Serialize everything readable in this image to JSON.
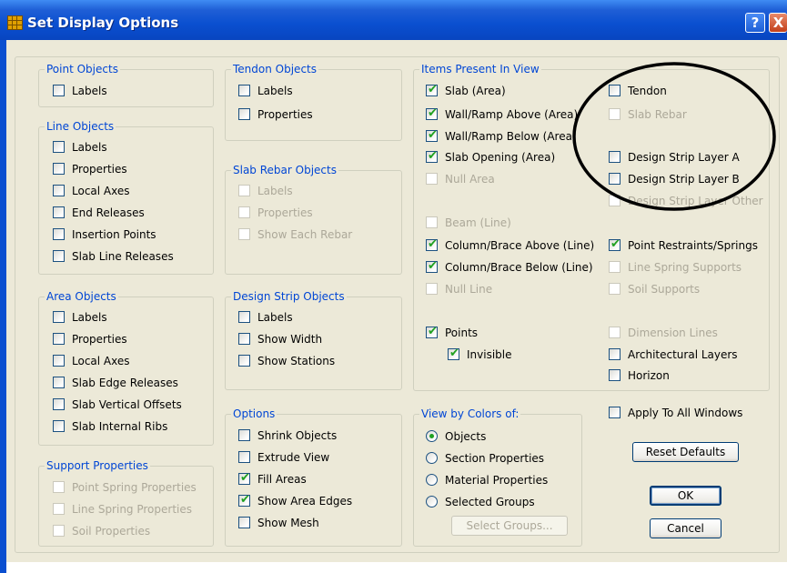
{
  "window": {
    "title": "Set Display Options",
    "help_glyph": "?",
    "close_glyph": "X"
  },
  "point_objects": {
    "title": "Point Objects",
    "items": [
      {
        "label": "Labels",
        "checked": false,
        "enabled": true
      }
    ]
  },
  "line_objects": {
    "title": "Line Objects",
    "items": [
      {
        "label": "Labels",
        "checked": false,
        "enabled": true
      },
      {
        "label": "Properties",
        "checked": false,
        "enabled": true
      },
      {
        "label": "Local Axes",
        "checked": false,
        "enabled": true
      },
      {
        "label": "End Releases",
        "checked": false,
        "enabled": true
      },
      {
        "label": "Insertion Points",
        "checked": false,
        "enabled": true
      },
      {
        "label": "Slab Line Releases",
        "checked": false,
        "enabled": true
      }
    ]
  },
  "area_objects": {
    "title": "Area Objects",
    "items": [
      {
        "label": "Labels",
        "checked": false,
        "enabled": true
      },
      {
        "label": "Properties",
        "checked": false,
        "enabled": true
      },
      {
        "label": "Local Axes",
        "checked": false,
        "enabled": true
      },
      {
        "label": "Slab Edge Releases",
        "checked": false,
        "enabled": true
      },
      {
        "label": "Slab Vertical Offsets",
        "checked": false,
        "enabled": true
      },
      {
        "label": "Slab Internal Ribs",
        "checked": false,
        "enabled": true
      }
    ]
  },
  "support_properties": {
    "title": "Support Properties",
    "items": [
      {
        "label": "Point Spring Properties",
        "checked": false,
        "enabled": false
      },
      {
        "label": "Line Spring Properties",
        "checked": false,
        "enabled": false
      },
      {
        "label": "Soil Properties",
        "checked": false,
        "enabled": false
      }
    ]
  },
  "tendon_objects": {
    "title": "Tendon Objects",
    "items": [
      {
        "label": "Labels",
        "checked": false,
        "enabled": true
      },
      {
        "label": "Properties",
        "checked": false,
        "enabled": true
      }
    ]
  },
  "slab_rebar_objects": {
    "title": "Slab Rebar Objects",
    "items": [
      {
        "label": "Labels",
        "checked": false,
        "enabled": false
      },
      {
        "label": "Properties",
        "checked": false,
        "enabled": false
      },
      {
        "label": "Show Each Rebar",
        "checked": false,
        "enabled": false
      }
    ]
  },
  "design_strip_objects": {
    "title": "Design Strip Objects",
    "items": [
      {
        "label": "Labels",
        "checked": false,
        "enabled": true
      },
      {
        "label": "Show Width",
        "checked": false,
        "enabled": true
      },
      {
        "label": "Show Stations",
        "checked": false,
        "enabled": true
      }
    ]
  },
  "options": {
    "title": "Options",
    "items": [
      {
        "label": "Shrink Objects",
        "checked": false,
        "enabled": true
      },
      {
        "label": "Extrude View",
        "checked": false,
        "enabled": true
      },
      {
        "label": "Fill Areas",
        "checked": true,
        "enabled": true
      },
      {
        "label": "Show Area Edges",
        "checked": true,
        "enabled": true
      },
      {
        "label": "Show Mesh",
        "checked": false,
        "enabled": true
      }
    ]
  },
  "items_present": {
    "title": "Items Present In View",
    "col1": [
      {
        "label": "Slab (Area)",
        "checked": true,
        "enabled": true
      },
      {
        "label": "Wall/Ramp Above (Area)",
        "checked": true,
        "enabled": true
      },
      {
        "label": "Wall/Ramp Below (Area)",
        "checked": true,
        "enabled": true
      },
      {
        "label": "Slab Opening (Area)",
        "checked": true,
        "enabled": true
      },
      {
        "label": "Null Area",
        "checked": false,
        "enabled": false
      },
      {
        "label": "Beam (Line)",
        "checked": false,
        "enabled": false
      },
      {
        "label": "Column/Brace Above (Line)",
        "checked": true,
        "enabled": true
      },
      {
        "label": "Column/Brace Below (Line)",
        "checked": true,
        "enabled": true
      },
      {
        "label": "Null Line",
        "checked": false,
        "enabled": false
      },
      {
        "label": "Points",
        "checked": true,
        "enabled": true
      },
      {
        "label": "Invisible",
        "checked": true,
        "enabled": true
      }
    ],
    "col2": [
      {
        "label": "Tendon",
        "checked": false,
        "enabled": true
      },
      {
        "label": "Slab Rebar",
        "checked": false,
        "enabled": false
      },
      {
        "label": "Design Strip Layer A",
        "checked": false,
        "enabled": true
      },
      {
        "label": "Design Strip Layer B",
        "checked": false,
        "enabled": true
      },
      {
        "label": "Design Strip Layer Other",
        "checked": false,
        "enabled": false
      },
      {
        "label": "Point Restraints/Springs",
        "checked": true,
        "enabled": true
      },
      {
        "label": "Line Spring Supports",
        "checked": false,
        "enabled": false
      },
      {
        "label": "Soil Supports",
        "checked": false,
        "enabled": false
      },
      {
        "label": "Dimension Lines",
        "checked": false,
        "enabled": false
      },
      {
        "label": "Architectural Layers",
        "checked": false,
        "enabled": true
      },
      {
        "label": "Horizon",
        "checked": false,
        "enabled": true
      }
    ]
  },
  "view_by_colors": {
    "title": "View by Colors of:",
    "options": [
      {
        "label": "Objects",
        "selected": true
      },
      {
        "label": "Section Properties",
        "selected": false
      },
      {
        "label": "Material Properties",
        "selected": false
      },
      {
        "label": "Selected Groups",
        "selected": false
      }
    ],
    "select_groups_label": "Select Groups..."
  },
  "apply_all": {
    "label": "Apply To All Windows",
    "checked": false,
    "enabled": true
  },
  "buttons": {
    "reset": "Reset Defaults",
    "ok": "OK",
    "cancel": "Cancel"
  },
  "colors": {
    "title_bar": "#0a4fd0",
    "group_title": "#0046d5",
    "check_mark": "#21a121",
    "dialog_bg": "#ece9d8",
    "disabled_text": "#aca899"
  }
}
